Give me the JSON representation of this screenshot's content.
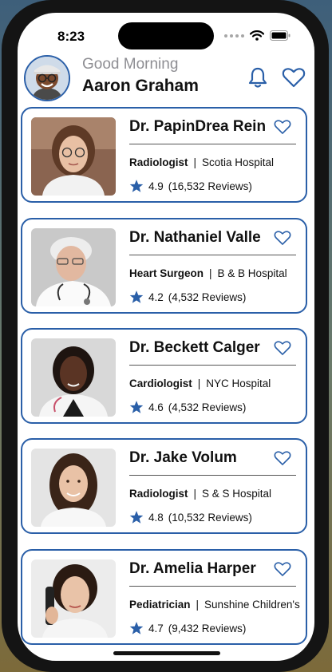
{
  "status_bar": {
    "time": "8:23"
  },
  "header": {
    "greeting": "Good Morning",
    "user_name": "Aaron Graham"
  },
  "doctors": [
    {
      "name": "Dr. PapinDrea Rein",
      "specialty": "Radiologist",
      "hospital": "Scotia Hospital",
      "rating": "4.9",
      "reviews": "(16,532 Reviews)"
    },
    {
      "name": "Dr. Nathaniel Valle",
      "specialty": "Heart Surgeon",
      "hospital": "B & B Hospital",
      "rating": "4.2",
      "reviews": "(4,532 Reviews)"
    },
    {
      "name": "Dr. Beckett Calger",
      "specialty": "Cardiologist",
      "hospital": "NYC Hospital",
      "rating": "4.6",
      "reviews": "(4,532 Reviews)"
    },
    {
      "name": "Dr. Jake Volum",
      "specialty": "Radiologist",
      "hospital": "S & S Hospital",
      "rating": "4.8",
      "reviews": "(10,532 Reviews)"
    },
    {
      "name": "Dr. Amelia Harper",
      "specialty": "Pediatrician",
      "hospital": "Sunshine Children's",
      "rating": "4.7",
      "reviews": "(9,432 Reviews)"
    }
  ],
  "colors": {
    "accent": "#2a5fa8",
    "text": "#111111",
    "muted": "#8e8e93"
  },
  "icons": {
    "notifications": "bell-icon",
    "favorites": "heart-icon",
    "rating": "star-icon"
  }
}
